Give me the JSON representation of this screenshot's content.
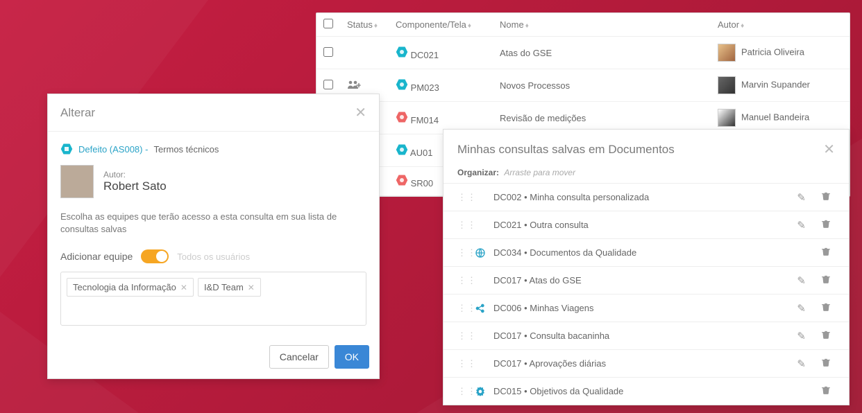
{
  "table": {
    "cols": {
      "status": "Status",
      "component": "Componente/Tela",
      "name": "Nome",
      "author": "Autor"
    },
    "rows": [
      {
        "status": "",
        "compCode": "DC021",
        "compColor": "#19b5cc",
        "name": "Atas do GSE",
        "author": "Patricia Oliveira",
        "avClass": "av1"
      },
      {
        "status": "shared",
        "compCode": "PM023",
        "compColor": "#19b5cc",
        "name": "Novos Processos",
        "author": "Marvin Supander",
        "avClass": "av2"
      },
      {
        "status": "",
        "compCode": "FM014",
        "compColor": "#e66",
        "name": "Revisão de medições",
        "author": "Manuel Bandeira",
        "avClass": "av3"
      },
      {
        "status": "",
        "compCode": "AU01",
        "compColor": "#19b5cc",
        "name": "",
        "author": "",
        "avClass": "av4"
      },
      {
        "status": "",
        "compCode": "SR00",
        "compColor": "#e66",
        "name": "",
        "author": "",
        "avClass": ""
      }
    ]
  },
  "alterar": {
    "title": "Alterar",
    "defectPrefix": "Defeito (AS008) -",
    "defectTitle": "Termos técnicos",
    "authorLabel": "Autor:",
    "authorName": "Robert Sato",
    "helper": "Escolha as equipes que terão acesso a esta consulta em sua lista de consultas salvas",
    "addTeam": "Adicionar equipe",
    "allUsers": "Todos os usuários",
    "tags": [
      "Tecnologia da Informação",
      "I&D Team"
    ],
    "cancel": "Cancelar",
    "ok": "OK"
  },
  "queries": {
    "title": "Minhas consultas salvas em Documentos",
    "organizeLabel": "Organizar:",
    "organizeHint": "Arraste para mover",
    "items": [
      {
        "icon": "",
        "label": "DC002 • Minha consulta personalizada",
        "edit": true,
        "del": true
      },
      {
        "icon": "",
        "label": "DC021 • Outra consulta",
        "edit": true,
        "del": true
      },
      {
        "icon": "globe",
        "label": "DC034 • Documentos da Qualidade",
        "edit": false,
        "del": true
      },
      {
        "icon": "",
        "label": "DC017 • Atas do GSE",
        "edit": true,
        "del": true
      },
      {
        "icon": "share",
        "label": "DC006 • Minhas Viagens",
        "edit": true,
        "del": true
      },
      {
        "icon": "",
        "label": "DC017 • Consulta bacaninha",
        "edit": true,
        "del": true
      },
      {
        "icon": "",
        "label": "DC017 • Aprovações diárias",
        "edit": true,
        "del": true
      },
      {
        "icon": "badge",
        "label": "DC015 • Objetivos da Qualidade",
        "edit": false,
        "del": true
      }
    ]
  }
}
